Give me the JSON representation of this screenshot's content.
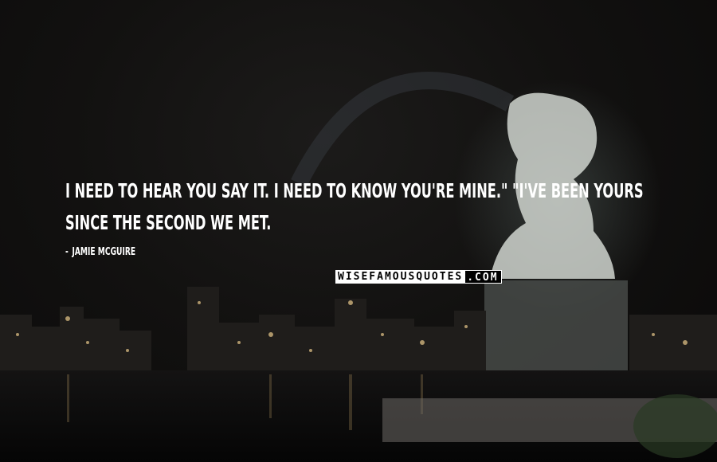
{
  "quote": {
    "text": "I need to hear you say it. I need to know you're mine.\" \"I've been yours since the second we met.",
    "author": "Jamie McGuire"
  },
  "watermark": {
    "left": "WISEFAMOUSQUOTES",
    "right": ".COM"
  },
  "colors": {
    "text": "#ffffff",
    "background": "#0b0a0a"
  }
}
